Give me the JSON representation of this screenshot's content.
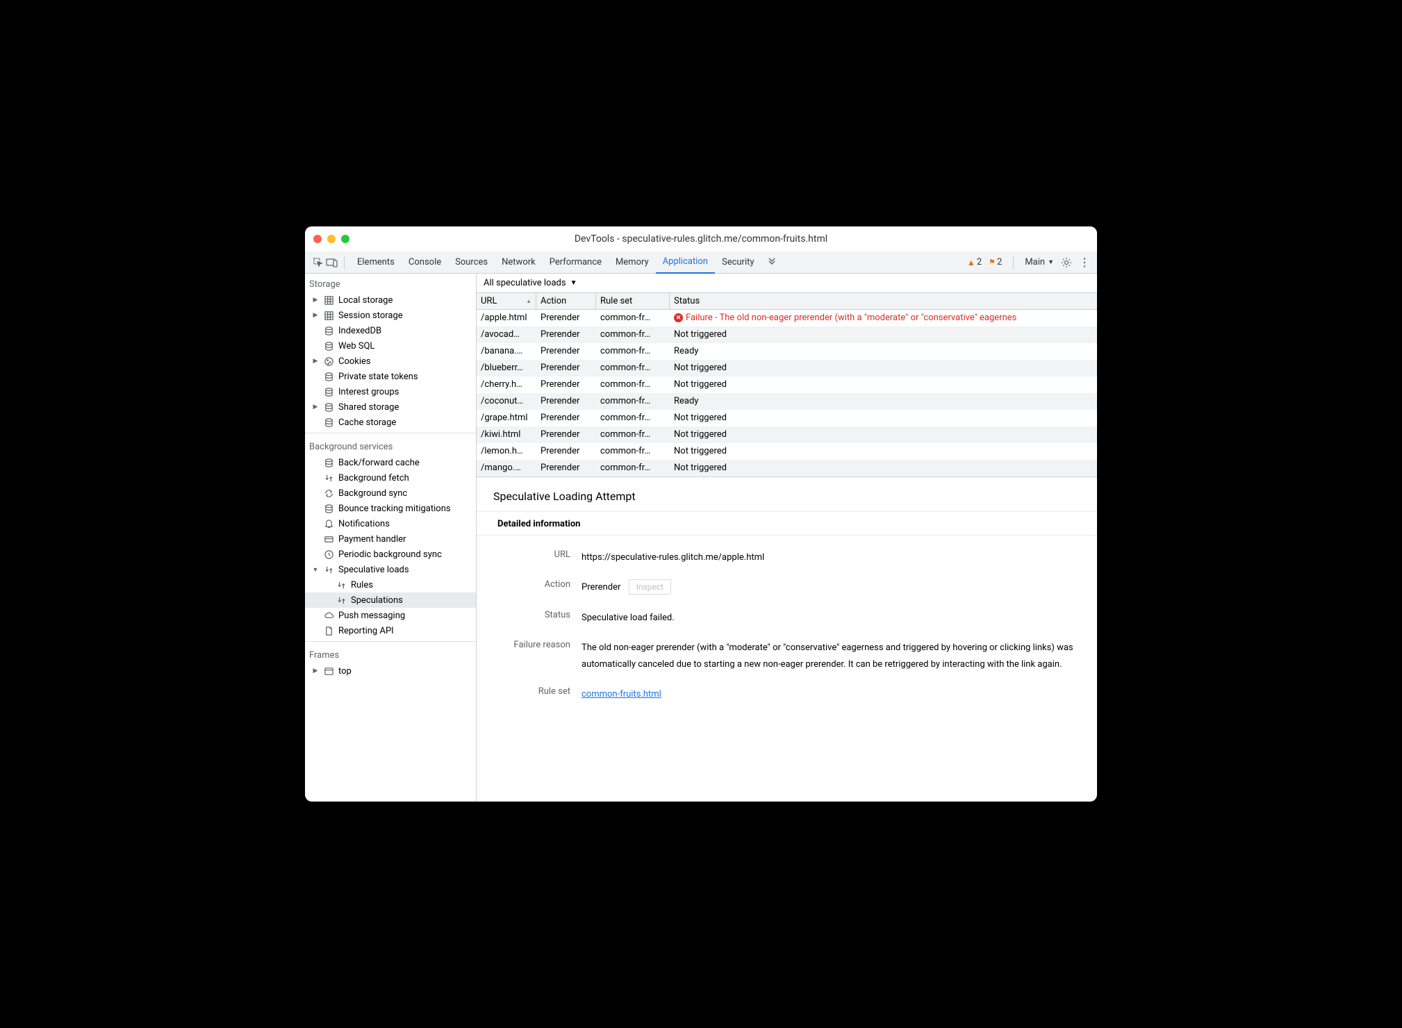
{
  "window_title": "DevTools - speculative-rules.glitch.me/common-fruits.html",
  "tabs": [
    "Elements",
    "Console",
    "Sources",
    "Network",
    "Performance",
    "Memory",
    "Application",
    "Security"
  ],
  "active_tab": "Application",
  "warnings_count": "2",
  "issues_count": "2",
  "frame_selector": "Main",
  "sidebar": {
    "storage_label": "Storage",
    "storage_items": [
      {
        "label": "Local storage",
        "icon": "grid",
        "expand": true
      },
      {
        "label": "Session storage",
        "icon": "grid",
        "expand": true
      },
      {
        "label": "IndexedDB",
        "icon": "db"
      },
      {
        "label": "Web SQL",
        "icon": "db"
      },
      {
        "label": "Cookies",
        "icon": "cookie",
        "expand": true
      },
      {
        "label": "Private state tokens",
        "icon": "db"
      },
      {
        "label": "Interest groups",
        "icon": "db"
      },
      {
        "label": "Shared storage",
        "icon": "db",
        "expand": true
      },
      {
        "label": "Cache storage",
        "icon": "db"
      }
    ],
    "bg_label": "Background services",
    "bg_items": [
      {
        "label": "Back/forward cache",
        "icon": "db"
      },
      {
        "label": "Background fetch",
        "icon": "arrows"
      },
      {
        "label": "Background sync",
        "icon": "sync"
      },
      {
        "label": "Bounce tracking mitigations",
        "icon": "db"
      },
      {
        "label": "Notifications",
        "icon": "bell"
      },
      {
        "label": "Payment handler",
        "icon": "card"
      },
      {
        "label": "Periodic background sync",
        "icon": "clock"
      },
      {
        "label": "Speculative loads",
        "icon": "arrows",
        "expand": true,
        "expanded": true
      },
      {
        "label": "Rules",
        "icon": "arrows",
        "child": true
      },
      {
        "label": "Speculations",
        "icon": "arrows",
        "child": true,
        "selected": true
      },
      {
        "label": "Push messaging",
        "icon": "cloud"
      },
      {
        "label": "Reporting API",
        "icon": "doc"
      }
    ],
    "frames_label": "Frames",
    "frames_items": [
      {
        "label": "top",
        "icon": "frame",
        "expand": true
      }
    ]
  },
  "filter_label": "All speculative loads",
  "columns": {
    "url": "URL",
    "action": "Action",
    "rule": "Rule set",
    "status": "Status"
  },
  "rows": [
    {
      "url": "/apple.html",
      "action": "Prerender",
      "rule": "common-fr…",
      "status": "Failure - The old non-eager prerender (with a \"moderate\" or \"conservative\" eagernes",
      "failure": true
    },
    {
      "url": "/avocad…",
      "action": "Prerender",
      "rule": "common-fr…",
      "status": "Not triggered"
    },
    {
      "url": "/banana.…",
      "action": "Prerender",
      "rule": "common-fr…",
      "status": "Ready"
    },
    {
      "url": "/blueberr…",
      "action": "Prerender",
      "rule": "common-fr…",
      "status": "Not triggered"
    },
    {
      "url": "/cherry.h…",
      "action": "Prerender",
      "rule": "common-fr…",
      "status": "Not triggered"
    },
    {
      "url": "/coconut…",
      "action": "Prerender",
      "rule": "common-fr…",
      "status": "Ready"
    },
    {
      "url": "/grape.html",
      "action": "Prerender",
      "rule": "common-fr…",
      "status": "Not triggered"
    },
    {
      "url": "/kiwi.html",
      "action": "Prerender",
      "rule": "common-fr…",
      "status": "Not triggered"
    },
    {
      "url": "/lemon.h…",
      "action": "Prerender",
      "rule": "common-fr…",
      "status": "Not triggered"
    },
    {
      "url": "/mango.…",
      "action": "Prerender",
      "rule": "common-fr…",
      "status": "Not triggered"
    }
  ],
  "detail": {
    "title": "Speculative Loading Attempt",
    "section": "Detailed information",
    "url_label": "URL",
    "url": "https://speculative-rules.glitch.me/apple.html",
    "action_label": "Action",
    "action": "Prerender",
    "inspect": "Inspect",
    "status_label": "Status",
    "status": "Speculative load failed.",
    "reason_label": "Failure reason",
    "reason": "The old non-eager prerender (with a \"moderate\" or \"conservative\" eagerness and triggered by hovering or clicking links) was automatically canceled due to starting a new non-eager prerender. It can be retriggered by interacting with the link again.",
    "ruleset_label": "Rule set",
    "ruleset": "common-fruits.html"
  }
}
